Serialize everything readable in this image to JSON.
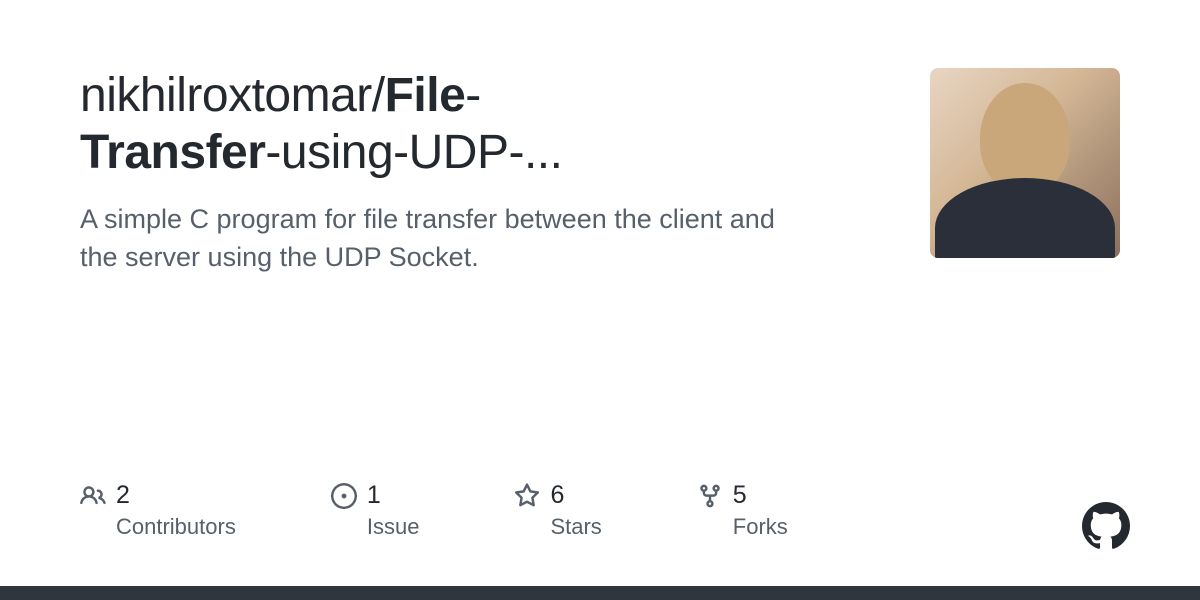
{
  "repo": {
    "owner": "nikhilroxtomar",
    "separator": "/",
    "name_part1": "File",
    "name_part2": "Transfer",
    "name_part3": "using",
    "name_part4": "UDP",
    "name_suffix": "-...",
    "description": "A simple C program for file transfer between the client and the server using the UDP Socket."
  },
  "stats": {
    "contributors": {
      "count": "2",
      "label": "Contributors"
    },
    "issues": {
      "count": "1",
      "label": "Issue"
    },
    "stars": {
      "count": "6",
      "label": "Stars"
    },
    "forks": {
      "count": "5",
      "label": "Forks"
    }
  }
}
